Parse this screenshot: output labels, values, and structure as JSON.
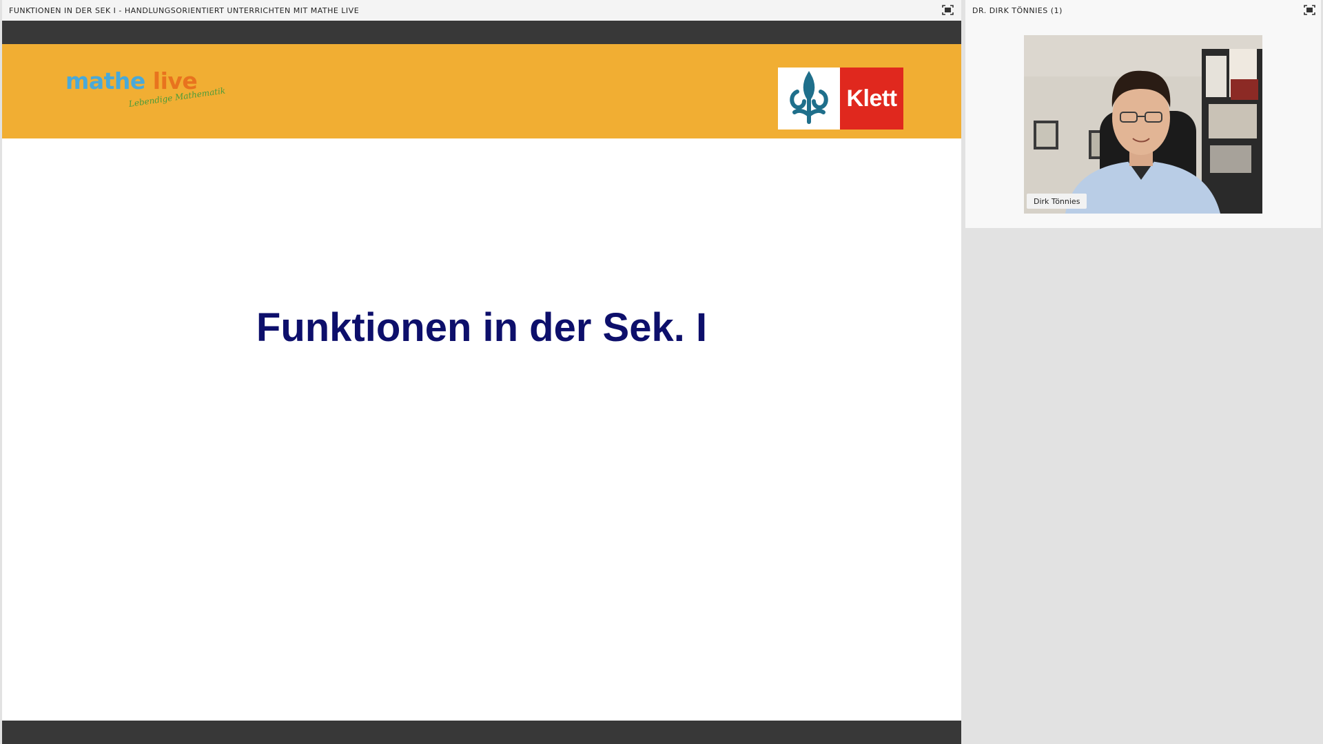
{
  "share_pod": {
    "title": "FUNKTIONEN IN DER SEK I - HANDLUNGSORIENTIERT UNTERRICHTEN MIT MATHE LIVE",
    "fullscreen_icon": "fullscreen-icon",
    "slide": {
      "brand": {
        "name_part_1": "mathe ",
        "name_part_2": "live",
        "tagline": "Lebendige Mathematik"
      },
      "publisher": {
        "wordmark": "Klett",
        "emblem_icon": "klett-emblem-icon"
      },
      "title": "Funktionen in der Sek. I"
    }
  },
  "video_pod": {
    "title": "DR. DIRK TÖNNIES (1)",
    "fullscreen_icon": "fullscreen-icon",
    "participant_name": "Dirk Tönnies"
  },
  "colors": {
    "banner": "#f1ae33",
    "dark_bar": "#383838",
    "slide_title": "#0d0f6b",
    "brand_blue": "#4aa9d8",
    "brand_orange": "#e8731e",
    "brand_green": "#4a9b3a",
    "publisher_red": "#e0281e",
    "publisher_teal": "#1f6f8b"
  }
}
